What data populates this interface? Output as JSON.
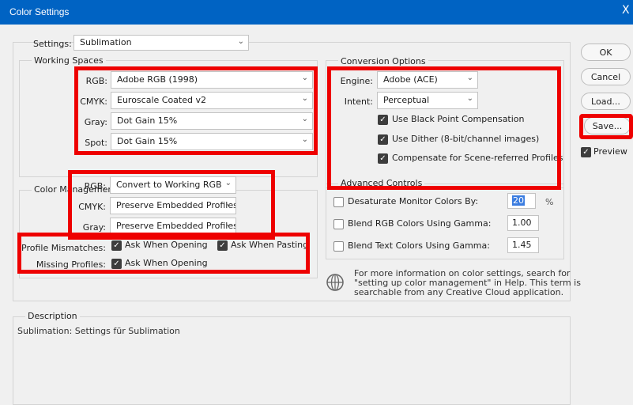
{
  "window": {
    "title": "Color Settings",
    "close_glyph": "X"
  },
  "settings": {
    "label": "Settings:",
    "value": "Sublimation"
  },
  "working_spaces": {
    "title": "Working Spaces",
    "rgb": {
      "label": "RGB:",
      "value": "Adobe RGB (1998)"
    },
    "cmyk": {
      "label": "CMYK:",
      "value": "Euroscale Coated v2"
    },
    "gray": {
      "label": "Gray:",
      "value": "Dot Gain 15%"
    },
    "spot": {
      "label": "Spot:",
      "value": "Dot Gain 15%"
    }
  },
  "policies": {
    "title": "Color Management Policies",
    "rgb": {
      "label": "RGB:",
      "value": "Convert to Working RGB"
    },
    "cmyk": {
      "label": "CMYK:",
      "value": "Preserve Embedded Profiles"
    },
    "gray": {
      "label": "Gray:",
      "value": "Preserve Embedded Profiles"
    },
    "profile_mismatches": {
      "label": "Profile Mismatches:",
      "ask_opening": "Ask When Opening",
      "ask_pasting": "Ask When Pasting"
    },
    "missing_profiles": {
      "label": "Missing Profiles:",
      "ask_opening": "Ask When Opening"
    }
  },
  "conversion": {
    "title": "Conversion Options",
    "engine": {
      "label": "Engine:",
      "value": "Adobe (ACE)"
    },
    "intent": {
      "label": "Intent:",
      "value": "Perceptual"
    },
    "black_point": "Use Black Point Compensation",
    "dither": "Use Dither (8-bit/channel images)",
    "scene_referred": "Compensate for Scene-referred Profiles"
  },
  "advanced": {
    "title": "Advanced Controls",
    "desaturate": {
      "label": "Desaturate Monitor Colors By:",
      "value": "20",
      "unit": "%"
    },
    "blend_rgb": {
      "label": "Blend RGB Colors Using Gamma:",
      "value": "1.00"
    },
    "blend_text": {
      "label": "Blend Text Colors Using Gamma:",
      "value": "1.45"
    }
  },
  "info": {
    "line1": "For more information on color settings, search for",
    "line2": "\"setting up color management\" in Help. This term is",
    "line3": "searchable from any Creative Cloud application."
  },
  "description": {
    "title": "Description",
    "text": "Sublimation:  Settings für Sublimation"
  },
  "buttons": {
    "ok": "OK",
    "cancel": "Cancel",
    "load": "Load...",
    "save": "Save...",
    "preview": "Preview"
  },
  "colors": {
    "titlebar": "#0063c3",
    "highlight": "#ee0000",
    "checkbox": "#3d3d3d"
  }
}
